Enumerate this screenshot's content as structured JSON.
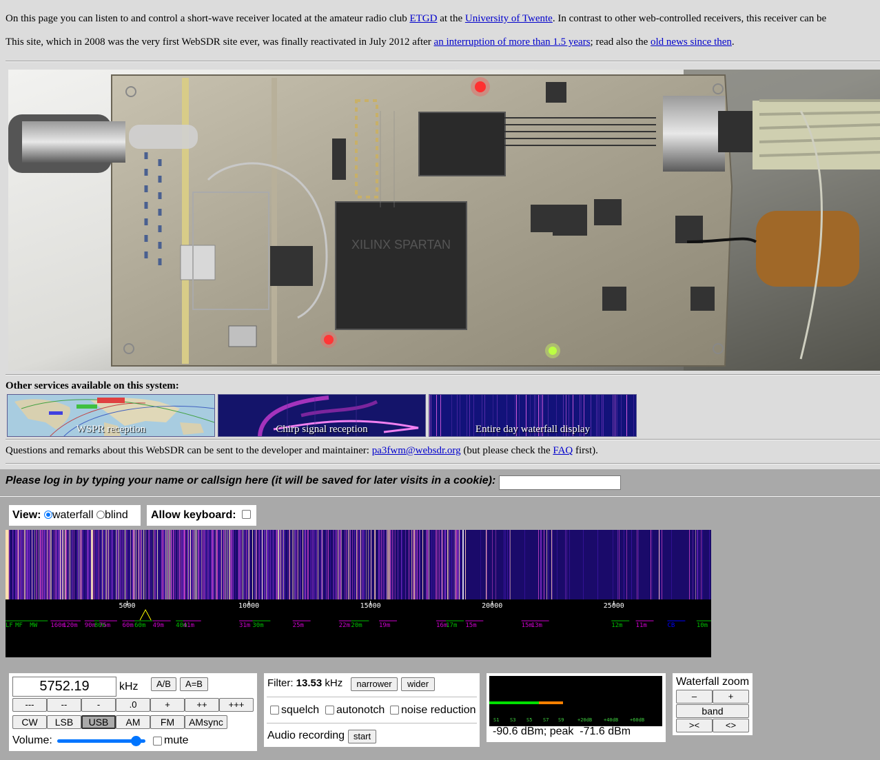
{
  "intro": {
    "line1_pre": "On this page you can listen to and control a short-wave receiver located at the amateur radio club ",
    "link_etgd": "ETGD",
    "line1_mid": " at the ",
    "link_ut": "University of Twente",
    "line1_post": ". In contrast to other web-controlled receivers, this receiver can be",
    "line2_pre": "This site, which in 2008 was the very first WebSDR site ever, was finally reactivated in July 2012 after ",
    "link_interruption": "an interruption of more than 1.5 years",
    "line2_mid": "; read also the ",
    "link_news": "old news since then",
    "line2_post": "."
  },
  "board_chip_label": "XILINX SPARTAN",
  "services": {
    "title": "Other services available on this system:",
    "items": [
      {
        "label": "WSPR reception"
      },
      {
        "label": "Chirp signal reception"
      },
      {
        "label": "Entire day waterfall display"
      }
    ]
  },
  "contact": {
    "pre": "Questions and remarks about this WebSDR can be sent to the developer and maintainer: ",
    "email": "pa3fwm@websdr.org",
    "mid": " (but please check the ",
    "faq": "FAQ",
    "post": " first)."
  },
  "login": {
    "prompt": "Please log in by typing your name or callsign here (it will be saved for later visits in a cookie):",
    "value": ""
  },
  "view": {
    "label": "View:",
    "waterfall": "waterfall",
    "blind": "blind",
    "selected": "waterfall",
    "allow_keyboard": "Allow keyboard:"
  },
  "scale": {
    "ticks": [
      5000,
      10000,
      15000,
      20000,
      25000
    ],
    "bands": [
      {
        "label": "LF",
        "khz": 0,
        "color": "#00c000"
      },
      {
        "label": "MF",
        "khz": 400,
        "color": "#00c000"
      },
      {
        "label": "MW",
        "khz": 1000,
        "color": "#00c000"
      },
      {
        "label": "160m",
        "khz": 1850,
        "color": "#d000d0"
      },
      {
        "label": "120m",
        "khz": 2350,
        "color": "#d000d0"
      },
      {
        "label": "90m",
        "khz": 3250,
        "color": "#d000d0"
      },
      {
        "label": "80m",
        "khz": 3650,
        "color": "#00c000"
      },
      {
        "label": "75m",
        "khz": 3850,
        "color": "#d000d0"
      },
      {
        "label": "60m",
        "khz": 4800,
        "color": "#d000d0"
      },
      {
        "label": "60m",
        "khz": 5300,
        "color": "#00c000"
      },
      {
        "label": "49m",
        "khz": 6050,
        "color": "#d000d0"
      },
      {
        "label": "40m",
        "khz": 7000,
        "color": "#00c000"
      },
      {
        "label": "41m",
        "khz": 7300,
        "color": "#d000d0"
      },
      {
        "label": "31m",
        "khz": 9600,
        "color": "#d000d0"
      },
      {
        "label": "30m",
        "khz": 10150,
        "color": "#00c000"
      },
      {
        "label": "25m",
        "khz": 11800,
        "color": "#d000d0"
      },
      {
        "label": "22m",
        "khz": 13700,
        "color": "#d000d0"
      },
      {
        "label": "20m",
        "khz": 14200,
        "color": "#00c000"
      },
      {
        "label": "19m",
        "khz": 15350,
        "color": "#d000d0"
      },
      {
        "label": "16m",
        "khz": 17700,
        "color": "#d000d0"
      },
      {
        "label": "17m",
        "khz": 18100,
        "color": "#00c000"
      },
      {
        "label": "15m",
        "khz": 18900,
        "color": "#d000d0"
      },
      {
        "label": "15m",
        "khz": 21200,
        "color": "#d000d0"
      },
      {
        "label": "13m",
        "khz": 21600,
        "color": "#d000d0"
      },
      {
        "label": "12m",
        "khz": 24900,
        "color": "#00c000"
      },
      {
        "label": "11m",
        "khz": 25900,
        "color": "#d000d0"
      },
      {
        "label": "CB",
        "khz": 27200,
        "color": "#0000ff"
      },
      {
        "label": "10m",
        "khz": 28400,
        "color": "#00c000"
      }
    ],
    "tuned_khz": 5752.19,
    "max_khz": 29000
  },
  "tuning": {
    "frequency": "5752.19",
    "unit": "kHz",
    "ab": "A/B",
    "a_eq_b": "A=B",
    "steps": [
      "---",
      "--",
      "-",
      ".0",
      "+",
      "++",
      "+++"
    ],
    "modes": [
      "CW",
      "LSB",
      "USB",
      "AM",
      "FM",
      "AMsync"
    ],
    "selected_mode": "USB",
    "volume_label": "Volume:",
    "volume_level": 0.95,
    "mute": "mute"
  },
  "filter": {
    "label": "Filter:",
    "bandwidth": "13.53",
    "unit": "kHz",
    "narrower": "narrower",
    "wider": "wider",
    "squelch": "squelch",
    "autonotch": "autonotch",
    "noise_reduction": "noise reduction",
    "audio_recording": "Audio recording",
    "start": "start"
  },
  "smeter": {
    "scale_labels": [
      "S1",
      "S3",
      "S5",
      "S7",
      "S9",
      "+20dB",
      "+40dB",
      "+60dB"
    ],
    "readout": "-90.6 dBm; peak  -71.6 dBm"
  },
  "zoom": {
    "title": "Waterfall zoom",
    "minus": "–",
    "plus": "+",
    "band": "band",
    "left": "><",
    "right": "<>"
  }
}
